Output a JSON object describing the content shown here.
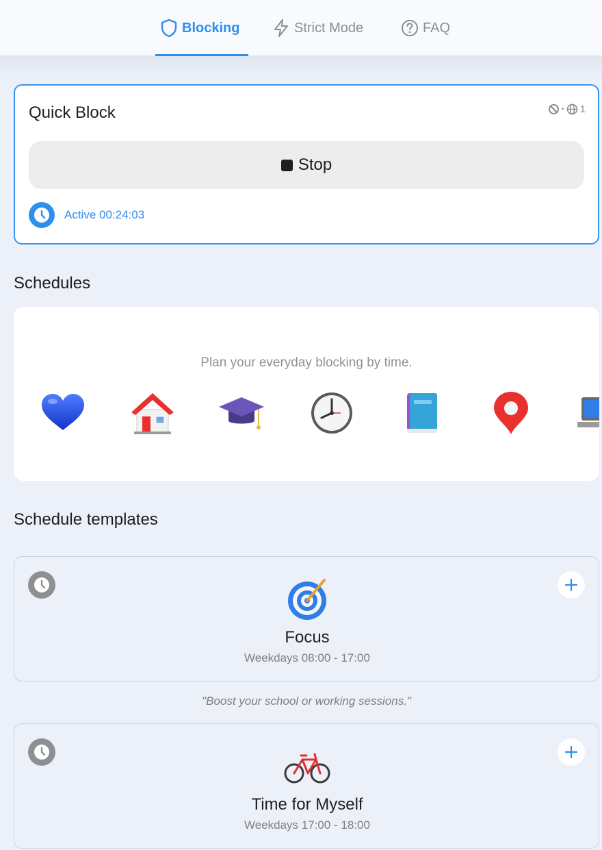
{
  "nav": {
    "tabs": [
      {
        "label": "Blocking",
        "icon": "shield-icon",
        "active": true
      },
      {
        "label": "Strict Mode",
        "icon": "lightning-icon",
        "active": false
      },
      {
        "label": "FAQ",
        "icon": "question-circle-icon",
        "active": false
      }
    ]
  },
  "quick_block": {
    "title": "Quick Block",
    "site_count": "1",
    "stop_label": "Stop",
    "status": "Active 00:24:03"
  },
  "schedules": {
    "title": "Schedules",
    "hint": "Plan your everyday blocking by time.",
    "icons": [
      "heart-icon",
      "house-icon",
      "graduation-cap-icon",
      "clock-icon",
      "book-icon",
      "location-pin-icon",
      "laptop-icon"
    ]
  },
  "templates": {
    "title": "Schedule templates",
    "items": [
      {
        "name": "Focus",
        "time": "Weekdays 08:00 - 17:00",
        "icon": "target-icon",
        "quote": "\"Boost your school or working sessions.\""
      },
      {
        "name": "Time for Myself",
        "time": "Weekdays 17:00 - 18:00",
        "icon": "bicycle-icon"
      }
    ]
  },
  "colors": {
    "accent": "#2d8ff0",
    "background": "#ecf0f8",
    "card": "#ffffff"
  }
}
